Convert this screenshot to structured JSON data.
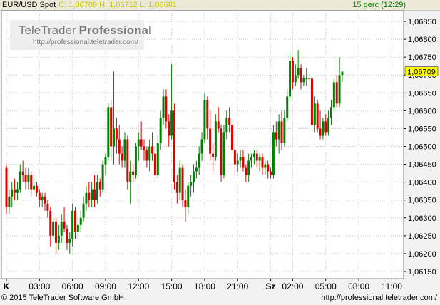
{
  "header": {
    "symbol": "EUR/USD Spot",
    "ohlc": "C: 1,06709 H: 1,06712 L: 1,06681",
    "interval": "15 perc (12:29)"
  },
  "watermark": {
    "brand_light": "TeleTrader",
    "brand_bold": "Professional",
    "url": "http://professional.teletrader.com/"
  },
  "footer": {
    "copyright": "© 2015 TeleTrader Software GmbH",
    "url": "http://professional.teletrader.com/"
  },
  "colors": {
    "up": "#008000",
    "down": "#e00000",
    "grid": "#c8c8c8",
    "price_box": "#ffff00"
  },
  "chart_data": {
    "type": "candlestick",
    "ylim": [
      1.0613,
      1.0688
    ],
    "yticks": [
      "1,06150",
      "1,06200",
      "1,06250",
      "1,06300",
      "1,06350",
      "1,06400",
      "1,06450",
      "1,06500",
      "1,06550",
      "1,06600",
      "1,06650",
      "1,06700",
      "1,06750",
      "1,06800",
      "1,06850"
    ],
    "last_price": "1,06709",
    "last_value": 1.06709,
    "xticks": [
      {
        "label": "K",
        "slot": 0,
        "bold": true
      },
      {
        "label": "03:00",
        "slot": 12
      },
      {
        "label": "06:00",
        "slot": 24
      },
      {
        "label": "09:00",
        "slot": 36
      },
      {
        "label": "12:00",
        "slot": 48
      },
      {
        "label": "15:00",
        "slot": 60
      },
      {
        "label": "18:00",
        "slot": 72
      },
      {
        "label": "21:00",
        "slot": 84
      },
      {
        "label": "Sz",
        "slot": 96,
        "bold": true
      },
      {
        "label": "02:00",
        "slot": 104
      },
      {
        "label": "05:00",
        "slot": 116
      },
      {
        "label": "08:00",
        "slot": 128
      },
      {
        "label": "11:00",
        "slot": 140
      }
    ],
    "candles": [
      [
        1.0644,
        1.0645,
        1.0631,
        1.0633
      ],
      [
        1.0633,
        1.0638,
        1.0631,
        1.0636
      ],
      [
        1.0636,
        1.064,
        1.0633,
        1.0638
      ],
      [
        1.0638,
        1.0641,
        1.0635,
        1.0637
      ],
      [
        1.0637,
        1.064,
        1.0635,
        1.0638
      ],
      [
        1.0638,
        1.0645,
        1.0637,
        1.0643
      ],
      [
        1.0643,
        1.0646,
        1.064,
        1.0642
      ],
      [
        1.0642,
        1.0644,
        1.0638,
        1.064
      ],
      [
        1.064,
        1.0644,
        1.0638,
        1.0642
      ],
      [
        1.0642,
        1.0643,
        1.0636,
        1.0638
      ],
      [
        1.0638,
        1.0642,
        1.0637,
        1.0639
      ],
      [
        1.0639,
        1.064,
        1.0636,
        1.0637
      ],
      [
        1.0637,
        1.0638,
        1.0633,
        1.0635
      ],
      [
        1.0635,
        1.0637,
        1.0633,
        1.0636
      ],
      [
        1.0636,
        1.0637,
        1.0632,
        1.0634
      ],
      [
        1.0634,
        1.0635,
        1.063,
        1.0632
      ],
      [
        1.0632,
        1.0633,
        1.0622,
        1.0625
      ],
      [
        1.0625,
        1.063,
        1.0624,
        1.0629
      ],
      [
        1.0629,
        1.063,
        1.062,
        1.0623
      ],
      [
        1.0623,
        1.0628,
        1.0621,
        1.0625
      ],
      [
        1.0625,
        1.0631,
        1.0623,
        1.0629
      ],
      [
        1.0629,
        1.0633,
        1.0626,
        1.0627
      ],
      [
        1.0627,
        1.0628,
        1.0621,
        1.0623
      ],
      [
        1.0623,
        1.0626,
        1.062,
        1.0624
      ],
      [
        1.0624,
        1.0634,
        1.0622,
        1.0632
      ],
      [
        1.0632,
        1.0633,
        1.0624,
        1.0626
      ],
      [
        1.0626,
        1.063,
        1.0624,
        1.0628
      ],
      [
        1.0628,
        1.0632,
        1.0626,
        1.063
      ],
      [
        1.063,
        1.0636,
        1.0629,
        1.0634
      ],
      [
        1.0634,
        1.0639,
        1.0632,
        1.0637
      ],
      [
        1.0637,
        1.064,
        1.0633,
        1.0635
      ],
      [
        1.0635,
        1.064,
        1.0633,
        1.0638
      ],
      [
        1.0638,
        1.0642,
        1.0633,
        1.0635
      ],
      [
        1.0635,
        1.0642,
        1.0634,
        1.064
      ],
      [
        1.064,
        1.0641,
        1.0636,
        1.0638
      ],
      [
        1.0638,
        1.0646,
        1.0637,
        1.0645
      ],
      [
        1.0645,
        1.0648,
        1.0642,
        1.0647
      ],
      [
        1.0647,
        1.0662,
        1.0646,
        1.0661
      ],
      [
        1.0661,
        1.0663,
        1.0646,
        1.065
      ],
      [
        1.065,
        1.0671,
        1.0645,
        1.0655
      ],
      [
        1.0655,
        1.0658,
        1.0648,
        1.0652
      ],
      [
        1.0652,
        1.0656,
        1.0645,
        1.0648
      ],
      [
        1.0648,
        1.065,
        1.0644,
        1.0646
      ],
      [
        1.0646,
        1.0654,
        1.0644,
        1.0652
      ],
      [
        1.0652,
        1.0653,
        1.0638,
        1.064
      ],
      [
        1.064,
        1.0646,
        1.0634,
        1.0643
      ],
      [
        1.0643,
        1.0645,
        1.064,
        1.0642
      ],
      [
        1.0642,
        1.0651,
        1.0641,
        1.065
      ],
      [
        1.065,
        1.0654,
        1.0646,
        1.0652
      ],
      [
        1.0652,
        1.0657,
        1.0649,
        1.065
      ],
      [
        1.065,
        1.0652,
        1.0646,
        1.0649
      ],
      [
        1.0649,
        1.065,
        1.0644,
        1.0646
      ],
      [
        1.0646,
        1.0652,
        1.0643,
        1.065
      ],
      [
        1.065,
        1.0654,
        1.0646,
        1.0648
      ],
      [
        1.0648,
        1.065,
        1.064,
        1.0642
      ],
      [
        1.0642,
        1.0653,
        1.0641,
        1.0651
      ],
      [
        1.0651,
        1.066,
        1.0649,
        1.0658
      ],
      [
        1.0658,
        1.0666,
        1.0656,
        1.0664
      ],
      [
        1.0664,
        1.0666,
        1.0655,
        1.0657
      ],
      [
        1.0657,
        1.0659,
        1.065,
        1.0653
      ],
      [
        1.0653,
        1.0673,
        1.0652,
        1.066
      ],
      [
        1.066,
        1.0662,
        1.0638,
        1.064
      ],
      [
        1.064,
        1.0642,
        1.0634,
        1.0637
      ],
      [
        1.0637,
        1.0646,
        1.0635,
        1.0644
      ],
      [
        1.0644,
        1.0645,
        1.0633,
        1.0635
      ],
      [
        1.0635,
        1.0638,
        1.0629,
        1.0633
      ],
      [
        1.0633,
        1.064,
        1.0631,
        1.0639
      ],
      [
        1.0639,
        1.0642,
        1.0636,
        1.064
      ],
      [
        1.064,
        1.0645,
        1.0637,
        1.0643
      ],
      [
        1.0643,
        1.0646,
        1.0641,
        1.0644
      ],
      [
        1.0644,
        1.065,
        1.0642,
        1.0648
      ],
      [
        1.0648,
        1.0654,
        1.0646,
        1.0652
      ],
      [
        1.0652,
        1.0665,
        1.0651,
        1.0663
      ],
      [
        1.0663,
        1.0664,
        1.0652,
        1.0655
      ],
      [
        1.0655,
        1.066,
        1.0646,
        1.0648
      ],
      [
        1.0648,
        1.0651,
        1.0643,
        1.0647
      ],
      [
        1.0647,
        1.0659,
        1.0646,
        1.0657
      ],
      [
        1.0657,
        1.0661,
        1.0654,
        1.0655
      ],
      [
        1.0655,
        1.0656,
        1.064,
        1.0642
      ],
      [
        1.0642,
        1.0656,
        1.0641,
        1.0654
      ],
      [
        1.0654,
        1.066,
        1.0652,
        1.0658
      ],
      [
        1.0658,
        1.0661,
        1.0654,
        1.0656
      ],
      [
        1.0656,
        1.0658,
        1.0646,
        1.0649
      ],
      [
        1.0649,
        1.065,
        1.0642,
        1.0645
      ],
      [
        1.0645,
        1.0648,
        1.0643,
        1.0646
      ],
      [
        1.0646,
        1.0649,
        1.0644,
        1.0647
      ],
      [
        1.0647,
        1.0649,
        1.0643,
        1.0644
      ],
      [
        1.0644,
        1.0645,
        1.064,
        1.0642
      ],
      [
        1.0642,
        1.0648,
        1.064,
        1.0646
      ],
      [
        1.0646,
        1.0648,
        1.0644,
        1.0647
      ],
      [
        1.0647,
        1.0649,
        1.0645,
        1.0648
      ],
      [
        1.0648,
        1.0649,
        1.0644,
        1.0646
      ],
      [
        1.0646,
        1.0648,
        1.0643,
        1.0647
      ],
      [
        1.0647,
        1.0648,
        1.0642,
        1.0644
      ],
      [
        1.0644,
        1.0646,
        1.0642,
        1.0645
      ],
      [
        1.0645,
        1.0646,
        1.0641,
        1.0643
      ],
      [
        1.0643,
        1.0644,
        1.0641,
        1.0642
      ],
      [
        1.0642,
        1.0656,
        1.0641,
        1.0654
      ],
      [
        1.0654,
        1.0657,
        1.065,
        1.0652
      ],
      [
        1.0652,
        1.0659,
        1.0648,
        1.0657
      ],
      [
        1.0657,
        1.066,
        1.0649,
        1.0651
      ],
      [
        1.0651,
        1.066,
        1.065,
        1.0658
      ],
      [
        1.0658,
        1.0666,
        1.0657,
        1.0664
      ],
      [
        1.0664,
        1.0676,
        1.0663,
        1.0674
      ],
      [
        1.0674,
        1.0675,
        1.0666,
        1.0668
      ],
      [
        1.0668,
        1.0673,
        1.0667,
        1.067
      ],
      [
        1.067,
        1.0677,
        1.0669,
        1.0672
      ],
      [
        1.0672,
        1.0673,
        1.0666,
        1.0668
      ],
      [
        1.0668,
        1.067,
        1.0667,
        1.0669
      ],
      [
        1.0669,
        1.0672,
        1.0667,
        1.0669
      ],
      [
        1.0669,
        1.067,
        1.0666,
        1.0669
      ],
      [
        1.0669,
        1.067,
        1.0654,
        1.0656
      ],
      [
        1.0656,
        1.0664,
        1.0654,
        1.0662
      ],
      [
        1.0662,
        1.0663,
        1.0654,
        1.0655
      ],
      [
        1.0655,
        1.066,
        1.0652,
        1.0653
      ],
      [
        1.0653,
        1.0658,
        1.0652,
        1.0657
      ],
      [
        1.0657,
        1.0659,
        1.0653,
        1.0654
      ],
      [
        1.0654,
        1.066,
        1.0653,
        1.0658
      ],
      [
        1.0658,
        1.0663,
        1.0656,
        1.0661
      ],
      [
        1.0661,
        1.0669,
        1.066,
        1.0668
      ],
      [
        1.0668,
        1.067,
        1.0661,
        1.0662
      ],
      [
        1.0662,
        1.0675,
        1.0661,
        1.067
      ],
      [
        1.067,
        1.06712,
        1.06681,
        1.06709
      ]
    ]
  }
}
